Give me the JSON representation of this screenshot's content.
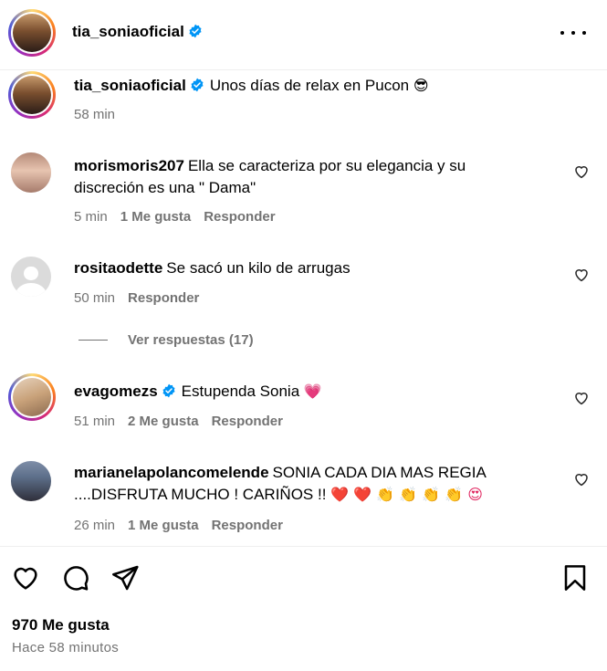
{
  "header": {
    "username": "tia_soniaoficial",
    "avatar_icon": "profile-photo-icon",
    "verified_icon": "verified-badge-icon",
    "more_icon": "more-options-icon"
  },
  "caption": {
    "username": "tia_soniaoficial",
    "text": "Unos días de relax en Pucon",
    "emoji": "😎",
    "time": "58 min"
  },
  "comments": [
    {
      "username": "morismoris207",
      "text": "Ella se caracteriza por su elegancia y su discreción es una \" Dama\"",
      "time": "5 min",
      "likes": "1 Me gusta",
      "reply": "Responder"
    },
    {
      "username": "rositaodette",
      "text": "Se sacó un kilo de arrugas",
      "time": "50 min",
      "reply": "Responder",
      "view_replies": "Ver respuestas (17)"
    },
    {
      "username": "evagomezs",
      "text": "Estupenda Sonia",
      "emoji": "💗",
      "time": "51 min",
      "likes": "2 Me gusta",
      "reply": "Responder"
    },
    {
      "username": "marianelapolancomelende",
      "text": "SONIA CADA DIA MAS REGIA ....DISFRUTA MUCHO ! CARIÑOS !!",
      "emoji": "❤️ ❤️ 👏 👏 👏 👏 😍",
      "time": "26 min",
      "likes": "1 Me gusta",
      "reply": "Responder"
    }
  ],
  "actions": {
    "like_icon": "heart-icon",
    "comment_icon": "comment-icon",
    "share_icon": "send-icon",
    "save_icon": "bookmark-icon"
  },
  "footer": {
    "likes": "970 Me gusta",
    "time_ago": "Hace 58 minutos"
  },
  "colors": {
    "verified": "#0095f6",
    "muted": "#737373",
    "divider": "#efefef"
  }
}
